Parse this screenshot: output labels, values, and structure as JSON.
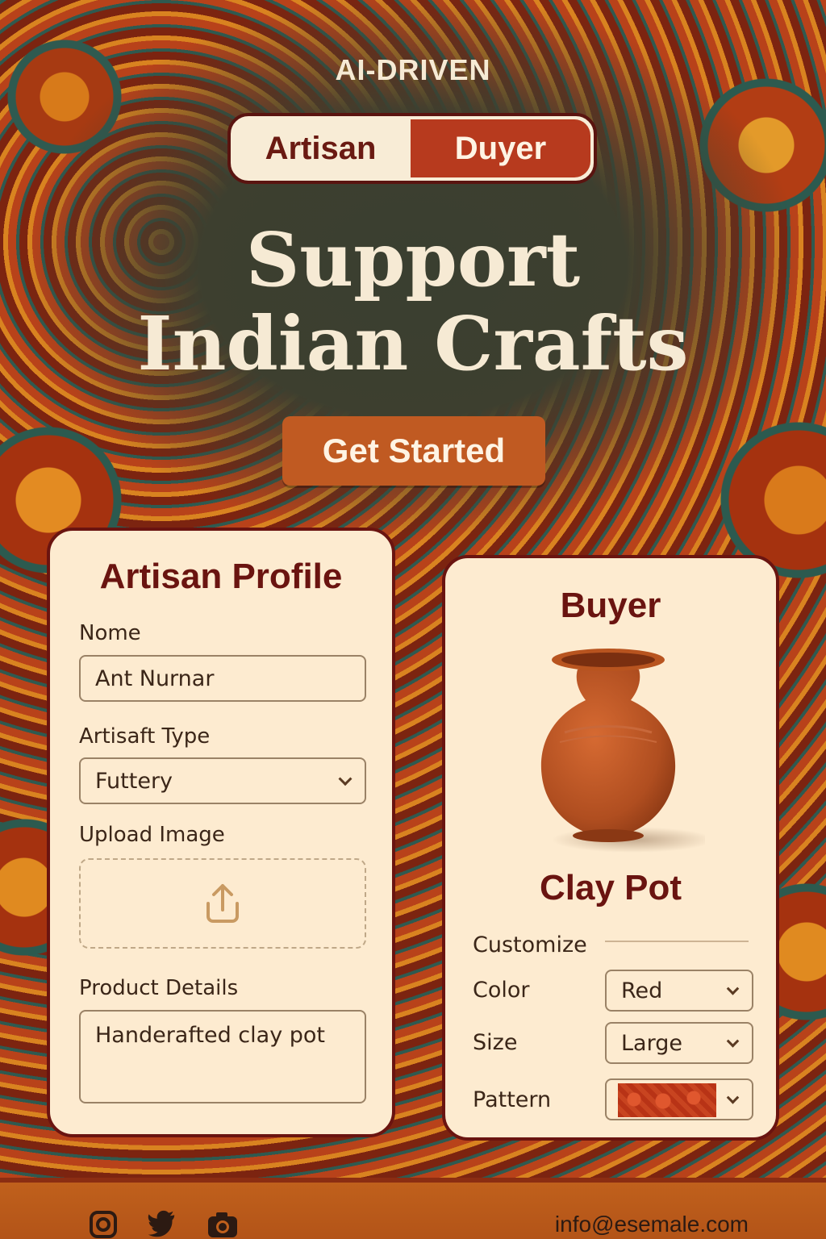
{
  "header": {
    "tagline": "AI-DRIVEN",
    "toggle": {
      "artisan_label": "Artisan",
      "buyer_label": "Duyer",
      "active": "buyer"
    }
  },
  "hero": {
    "line1": "Support",
    "line2": "Indian Crafts",
    "cta_label": "Get Started"
  },
  "artisan_card": {
    "title": "Artisan Profile",
    "name_label": "Nome",
    "name_value": "Ant Nurnar",
    "type_label": "Artisaft Type",
    "type_value": "Futtery",
    "upload_label": "Upload Image",
    "upload_icon": "upload-icon",
    "details_label": "Product Details",
    "details_value": "Handerafted clay pot"
  },
  "buyer_card": {
    "title": "Buyer",
    "product_name": "Clay Pot",
    "customize_label": "Customize",
    "options": {
      "color_label": "Color",
      "color_value": "Red",
      "size_label": "Size",
      "size_value": "Large",
      "pattern_label": "Pattern"
    }
  },
  "footer": {
    "icons": [
      "instagram-icon",
      "twitter-icon",
      "camera-icon"
    ],
    "email": "info@esemale.com"
  },
  "colors": {
    "brand_dark": "#6a1410",
    "accent": "#b73a1e",
    "cta": "#c05a22",
    "card_bg": "#fdebd0"
  }
}
